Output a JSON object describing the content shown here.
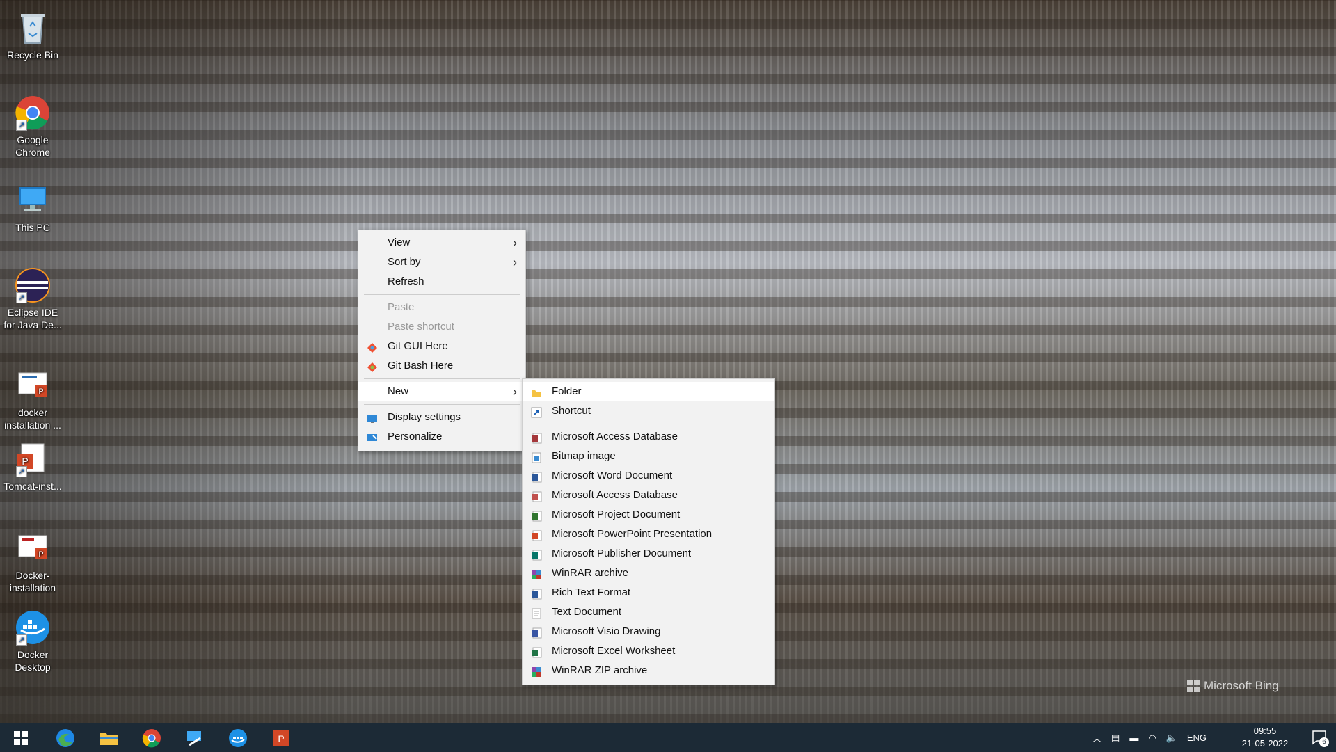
{
  "desktop": {
    "icons": [
      {
        "label": "Recycle Bin"
      },
      {
        "label": "Google Chrome"
      },
      {
        "label": "This PC"
      },
      {
        "label": "Eclipse IDE for Java De..."
      },
      {
        "label": "docker installation ..."
      },
      {
        "label": "Tomcat-inst..."
      },
      {
        "label": "Docker-installation"
      },
      {
        "label": "Docker Desktop"
      }
    ],
    "watermark": "Microsoft Bing"
  },
  "context_menu": {
    "items": [
      {
        "label": "View"
      },
      {
        "label": "Sort by"
      },
      {
        "label": "Refresh"
      },
      {
        "label": "Paste"
      },
      {
        "label": "Paste shortcut"
      },
      {
        "label": "Git GUI Here"
      },
      {
        "label": "Git Bash Here"
      },
      {
        "label": "New"
      },
      {
        "label": "Display settings"
      },
      {
        "label": "Personalize"
      }
    ]
  },
  "new_submenu": {
    "items": [
      {
        "label": "Folder"
      },
      {
        "label": "Shortcut"
      },
      {
        "label": "Microsoft Access Database"
      },
      {
        "label": "Bitmap image"
      },
      {
        "label": "Microsoft Word Document"
      },
      {
        "label": "Microsoft Access Database"
      },
      {
        "label": "Microsoft Project Document"
      },
      {
        "label": "Microsoft PowerPoint Presentation"
      },
      {
        "label": "Microsoft Publisher Document"
      },
      {
        "label": "WinRAR archive"
      },
      {
        "label": "Rich Text Format"
      },
      {
        "label": "Text Document"
      },
      {
        "label": "Microsoft Visio Drawing"
      },
      {
        "label": "Microsoft Excel Worksheet"
      },
      {
        "label": "WinRAR ZIP archive"
      }
    ]
  },
  "taskbar": {
    "language": "ENG",
    "time": "09:55",
    "date": "21-05-2022",
    "notification_count": "6"
  }
}
